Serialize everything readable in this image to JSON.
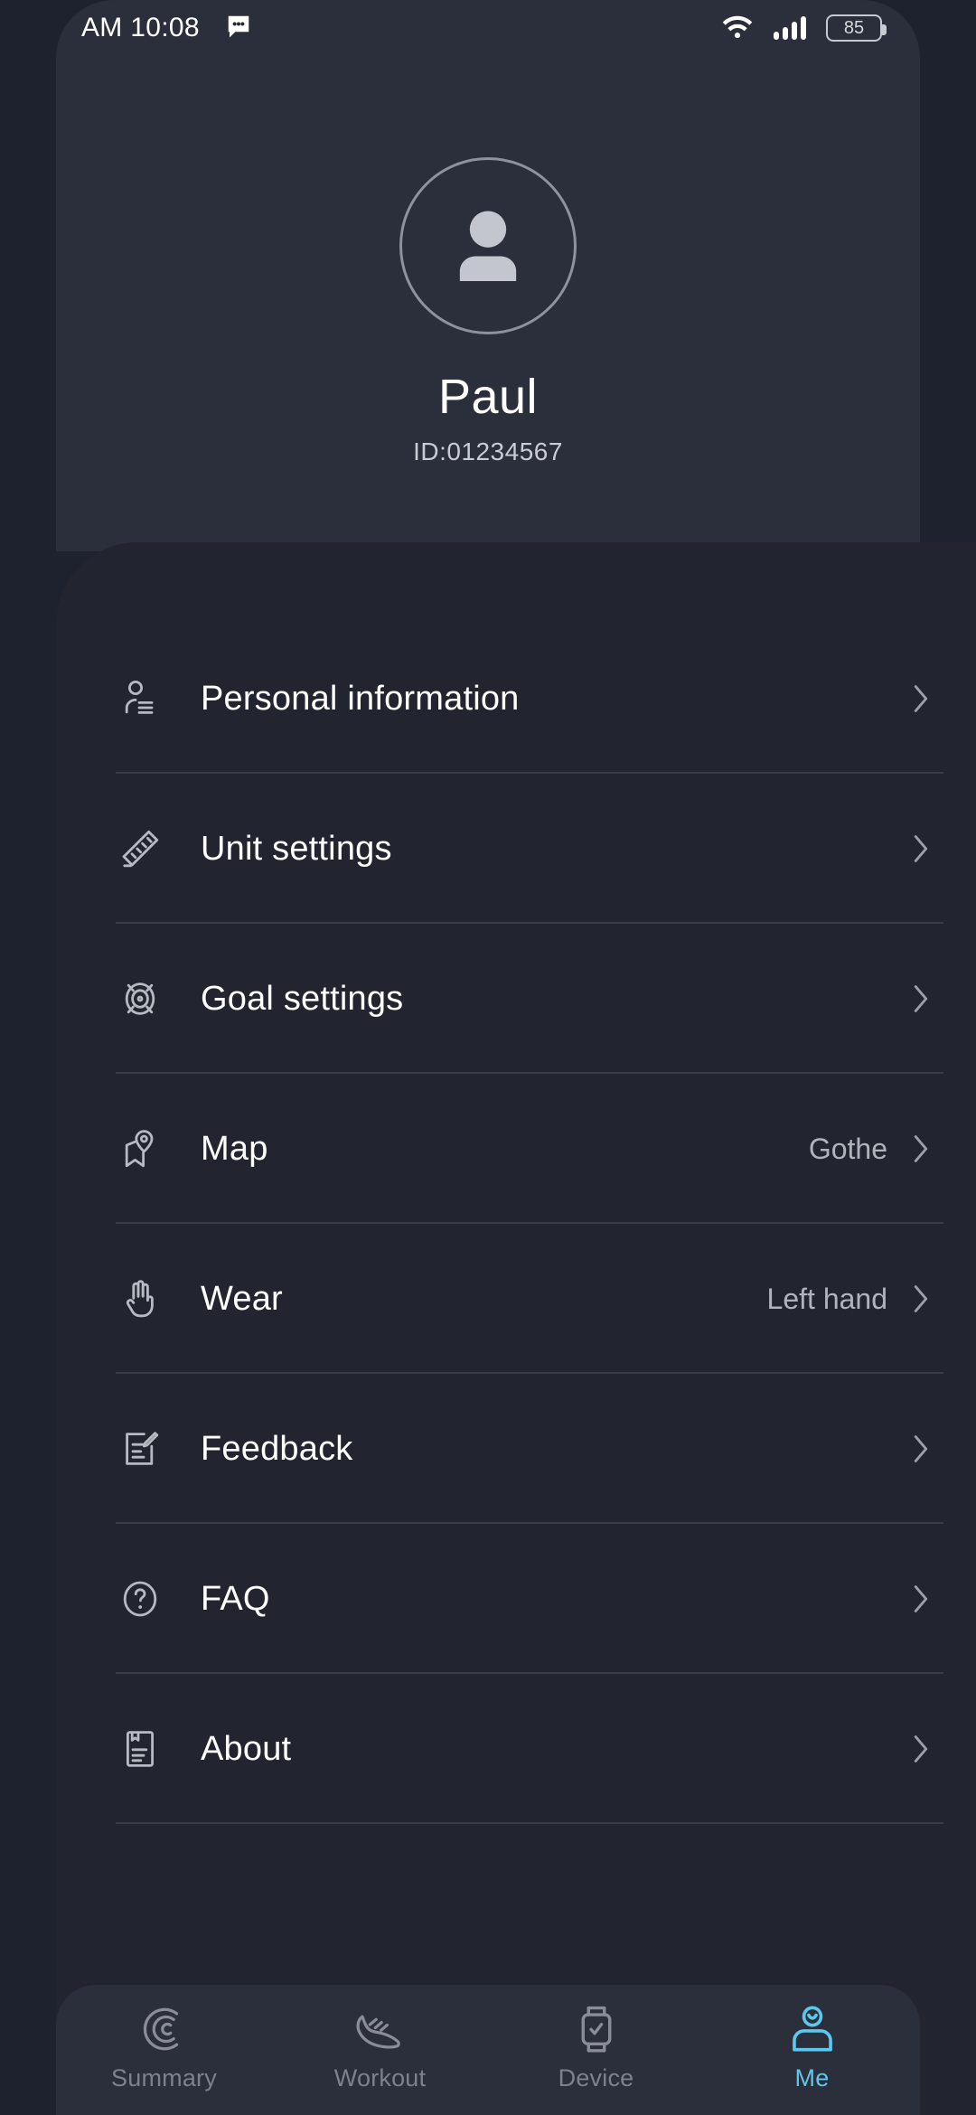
{
  "status_bar": {
    "clock": "AM 10:08",
    "message_icon": "message-bubble-icon",
    "wifi_icon": "wifi-icon",
    "signal_icon": "cellular-signal-icon",
    "battery_level": "85"
  },
  "profile": {
    "avatar_icon": "person-avatar-icon",
    "name": "Paul",
    "id": "ID:01234567"
  },
  "menu": {
    "items": [
      {
        "label": "Personal information",
        "value": "",
        "icon": "person-lines-icon"
      },
      {
        "label": "Unit settings",
        "value": "",
        "icon": "ruler-icon"
      },
      {
        "label": "Goal settings",
        "value": "",
        "icon": "target-icon"
      },
      {
        "label": "Map",
        "value": "Gothe",
        "icon": "map-pin-icon"
      },
      {
        "label": "Wear",
        "value": "Left hand",
        "icon": "hand-icon"
      },
      {
        "label": "Feedback",
        "value": "",
        "icon": "note-edit-icon"
      },
      {
        "label": "FAQ",
        "value": "",
        "icon": "question-circle-icon"
      },
      {
        "label": "About",
        "value": "",
        "icon": "bookmark-document-icon"
      }
    ]
  },
  "bottom_nav": {
    "active_index": 3,
    "accent_color": "#5dc8ee",
    "items": [
      {
        "label": "Summary",
        "icon": "rings-summary-icon"
      },
      {
        "label": "Workout",
        "icon": "running-shoe-icon"
      },
      {
        "label": "Device",
        "icon": "smartwatch-check-icon"
      },
      {
        "label": "Me",
        "icon": "person-me-icon"
      }
    ]
  }
}
